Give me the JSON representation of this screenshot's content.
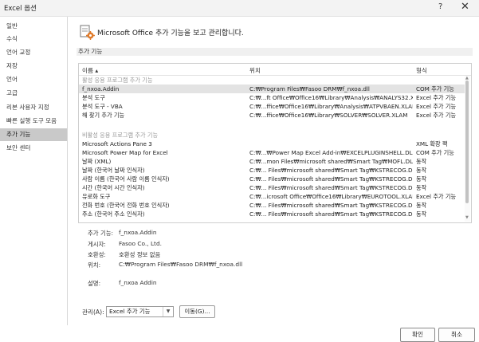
{
  "window": {
    "title": "Excel 옵션",
    "help_glyph": "?",
    "close_glyph": "✕"
  },
  "sidebar": {
    "items": [
      {
        "label": "일반"
      },
      {
        "label": "수식"
      },
      {
        "label": "언어 교정"
      },
      {
        "label": "저장"
      },
      {
        "label": "언어"
      },
      {
        "label": "고급"
      },
      {
        "label": "리본 사용자 지정"
      },
      {
        "label": "빠른 실행 도구 모음"
      },
      {
        "label": "추가 기능",
        "selected": true
      },
      {
        "label": "보안 센터"
      }
    ]
  },
  "header": {
    "text": "Microsoft Office 추가 기능을 보고 관리합니다.",
    "icon": "gear-addin-icon"
  },
  "section": {
    "title": "추가 기능"
  },
  "list": {
    "columns": {
      "name": "이름 ▴",
      "location": "위치",
      "type": "형식"
    },
    "rows": [
      {
        "group": true,
        "name": "활성 응용 프로그램 추가 기능"
      },
      {
        "name": "f_nxoa.Addin",
        "location": "C:₩Program Files₩Fasoo DRM₩f_nxoa.dll",
        "type": "COM 추가 기능",
        "selected": true
      },
      {
        "name": "분석 도구",
        "location": "C:₩...ft Office₩Office16₩Library₩Analysis₩ANALYS32.XLL",
        "type": "Excel 추가 기능"
      },
      {
        "name": "분석 도구 - VBA",
        "location": "C:₩...ffice₩Office16₩Library₩Analysis₩ATPVBAEN.XLAM",
        "type": "Excel 추가 기능"
      },
      {
        "name": "해 찾기 추가 기능",
        "location": "C:₩...ffice₩Office16₩Library₩SOLVER₩SOLVER.XLAM",
        "type": "Excel 추가 기능"
      },
      {
        "group": true,
        "name": ""
      },
      {
        "group": true,
        "name": "비활성 응용 프로그램 추가 기능"
      },
      {
        "name": "Microsoft Actions Pane 3",
        "location": "",
        "type": "XML 확장 팩"
      },
      {
        "name": "Microsoft Power Map for Excel",
        "location": "C:₩...₩Power Map Excel Add-in₩EXCELPLUGINSHELL.DLL",
        "type": "COM 추가 기능"
      },
      {
        "name": "날짜 (XML)",
        "location": "C:₩...mon Files₩microsoft shared₩Smart Tag₩MOFL.DLL",
        "type": "동작"
      },
      {
        "name": "날짜 (한국어 날짜 인식자)",
        "location": "C:₩... Files₩microsoft shared₩Smart Tag₩KSTRECOG.DLL",
        "type": "동작"
      },
      {
        "name": "사람 이름 (한국어 사람 이름 인식자)",
        "location": "C:₩... Files₩microsoft shared₩Smart Tag₩KSTRECOG.DLL",
        "type": "동작"
      },
      {
        "name": "시간 (한국어 시간 인식자)",
        "location": "C:₩... Files₩microsoft shared₩Smart Tag₩KSTRECOG.DLL",
        "type": "동작"
      },
      {
        "name": "유로화 도구",
        "location": "C:₩...icrosoft Office₩Office16₩Library₩EUROTOOL.XLAM",
        "type": "Excel 추가 기능"
      },
      {
        "name": "전화 번호 (한국어 전화 번호 인식자)",
        "location": "C:₩... Files₩microsoft shared₩Smart Tag₩KSTRECOG.DLL",
        "type": "동작"
      },
      {
        "name": "주소 (한국어 주소 인식자)",
        "location": "C:₩... Files₩microsoft shared₩Smart Tag₩KSTRECOG.DLL",
        "type": "동작"
      }
    ]
  },
  "details": {
    "addin": {
      "label": "추가 기능:",
      "value": "f_nxoa.Addin"
    },
    "publisher": {
      "label": "게시자:",
      "value": "Fasoo Co., Ltd."
    },
    "compat": {
      "label": "호환성:",
      "value": "호환성 정보 없음"
    },
    "location": {
      "label": "위치:",
      "value": "C:₩Program Files₩Fasoo DRM₩f_nxoa.dll"
    },
    "description": {
      "label": "설명:",
      "value": "f_nxoa Addin"
    }
  },
  "manage": {
    "label": "관리(A):",
    "selected": "Excel 추가 기능",
    "go_label": "이동(G)..."
  },
  "footer": {
    "ok_label": "확인",
    "cancel_label": "취소"
  }
}
